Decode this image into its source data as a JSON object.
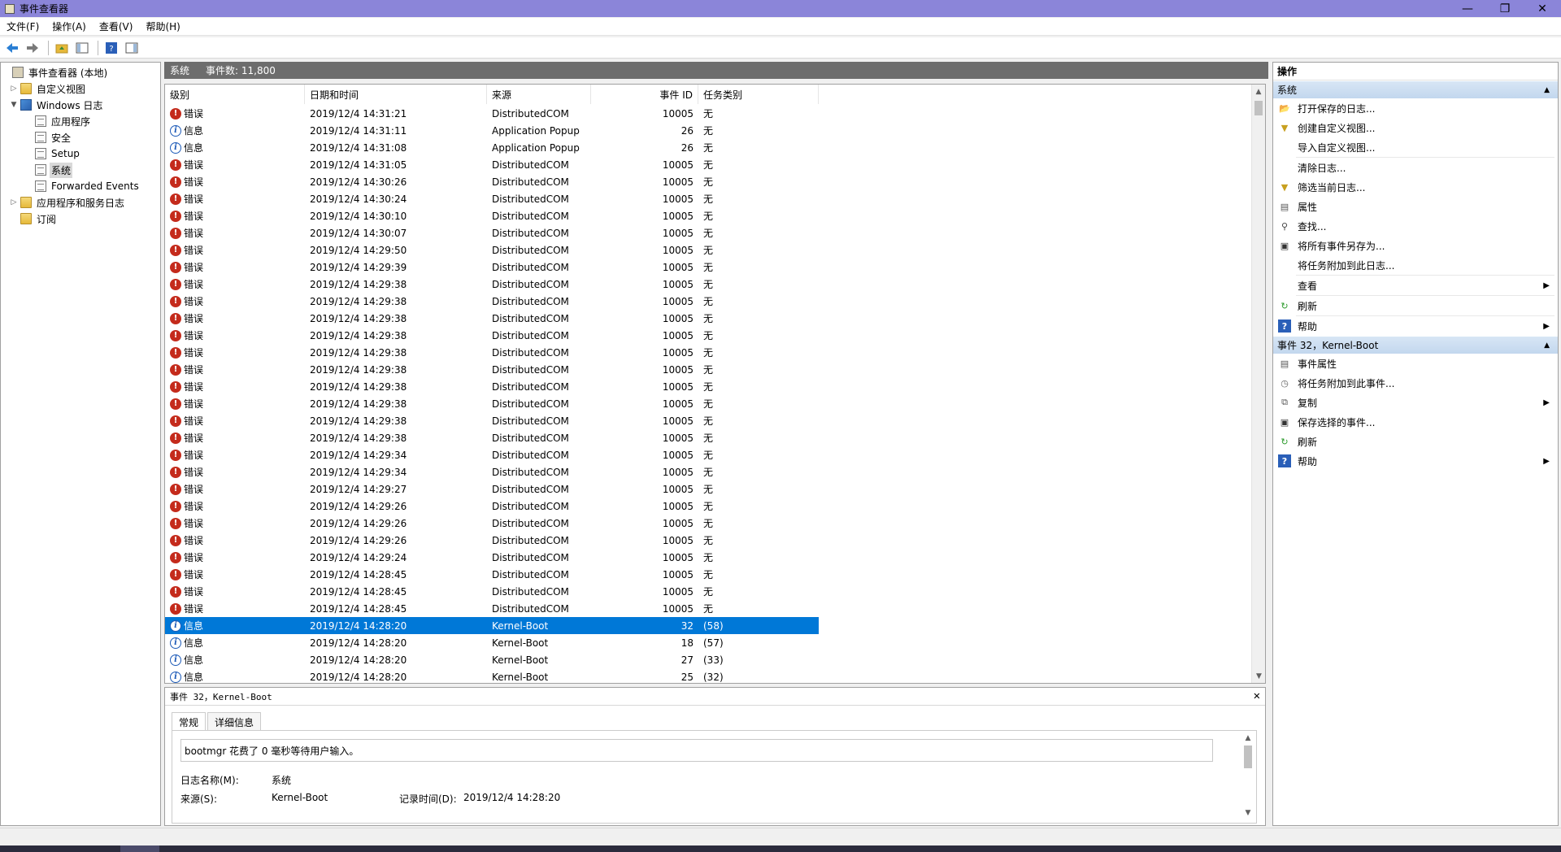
{
  "window": {
    "title": "事件查看器",
    "minimize": "—",
    "restore": "❐",
    "close": "✕"
  },
  "menu": [
    "文件(F)",
    "操作(A)",
    "查看(V)",
    "帮助(H)"
  ],
  "tree": {
    "root": "事件查看器 (本地)",
    "custom_views": "自定义视图",
    "windows_logs": "Windows 日志",
    "windows_log_items": [
      "应用程序",
      "安全",
      "Setup",
      "系统",
      "Forwarded Events"
    ],
    "app_service_logs": "应用程序和服务日志",
    "subscriptions": "订阅"
  },
  "center": {
    "log_name": "系统",
    "event_count": "事件数: 11,800"
  },
  "grid": {
    "columns": [
      "级别",
      "日期和时间",
      "来源",
      "事件 ID",
      "任务类别"
    ],
    "rows": [
      {
        "level": "错误",
        "type": "err",
        "date": "2019/12/4 14:31:21",
        "source": "DistributedCOM",
        "id": "10005",
        "task": "无"
      },
      {
        "level": "信息",
        "type": "info",
        "date": "2019/12/4 14:31:11",
        "source": "Application Popup",
        "id": "26",
        "task": "无"
      },
      {
        "level": "信息",
        "type": "info",
        "date": "2019/12/4 14:31:08",
        "source": "Application Popup",
        "id": "26",
        "task": "无"
      },
      {
        "level": "错误",
        "type": "err",
        "date": "2019/12/4 14:31:05",
        "source": "DistributedCOM",
        "id": "10005",
        "task": "无"
      },
      {
        "level": "错误",
        "type": "err",
        "date": "2019/12/4 14:30:26",
        "source": "DistributedCOM",
        "id": "10005",
        "task": "无"
      },
      {
        "level": "错误",
        "type": "err",
        "date": "2019/12/4 14:30:24",
        "source": "DistributedCOM",
        "id": "10005",
        "task": "无"
      },
      {
        "level": "错误",
        "type": "err",
        "date": "2019/12/4 14:30:10",
        "source": "DistributedCOM",
        "id": "10005",
        "task": "无"
      },
      {
        "level": "错误",
        "type": "err",
        "date": "2019/12/4 14:30:07",
        "source": "DistributedCOM",
        "id": "10005",
        "task": "无"
      },
      {
        "level": "错误",
        "type": "err",
        "date": "2019/12/4 14:29:50",
        "source": "DistributedCOM",
        "id": "10005",
        "task": "无"
      },
      {
        "level": "错误",
        "type": "err",
        "date": "2019/12/4 14:29:39",
        "source": "DistributedCOM",
        "id": "10005",
        "task": "无"
      },
      {
        "level": "错误",
        "type": "err",
        "date": "2019/12/4 14:29:38",
        "source": "DistributedCOM",
        "id": "10005",
        "task": "无"
      },
      {
        "level": "错误",
        "type": "err",
        "date": "2019/12/4 14:29:38",
        "source": "DistributedCOM",
        "id": "10005",
        "task": "无"
      },
      {
        "level": "错误",
        "type": "err",
        "date": "2019/12/4 14:29:38",
        "source": "DistributedCOM",
        "id": "10005",
        "task": "无"
      },
      {
        "level": "错误",
        "type": "err",
        "date": "2019/12/4 14:29:38",
        "source": "DistributedCOM",
        "id": "10005",
        "task": "无"
      },
      {
        "level": "错误",
        "type": "err",
        "date": "2019/12/4 14:29:38",
        "source": "DistributedCOM",
        "id": "10005",
        "task": "无"
      },
      {
        "level": "错误",
        "type": "err",
        "date": "2019/12/4 14:29:38",
        "source": "DistributedCOM",
        "id": "10005",
        "task": "无"
      },
      {
        "level": "错误",
        "type": "err",
        "date": "2019/12/4 14:29:38",
        "source": "DistributedCOM",
        "id": "10005",
        "task": "无"
      },
      {
        "level": "错误",
        "type": "err",
        "date": "2019/12/4 14:29:38",
        "source": "DistributedCOM",
        "id": "10005",
        "task": "无"
      },
      {
        "level": "错误",
        "type": "err",
        "date": "2019/12/4 14:29:38",
        "source": "DistributedCOM",
        "id": "10005",
        "task": "无"
      },
      {
        "level": "错误",
        "type": "err",
        "date": "2019/12/4 14:29:38",
        "source": "DistributedCOM",
        "id": "10005",
        "task": "无"
      },
      {
        "level": "错误",
        "type": "err",
        "date": "2019/12/4 14:29:34",
        "source": "DistributedCOM",
        "id": "10005",
        "task": "无"
      },
      {
        "level": "错误",
        "type": "err",
        "date": "2019/12/4 14:29:34",
        "source": "DistributedCOM",
        "id": "10005",
        "task": "无"
      },
      {
        "level": "错误",
        "type": "err",
        "date": "2019/12/4 14:29:27",
        "source": "DistributedCOM",
        "id": "10005",
        "task": "无"
      },
      {
        "level": "错误",
        "type": "err",
        "date": "2019/12/4 14:29:26",
        "source": "DistributedCOM",
        "id": "10005",
        "task": "无"
      },
      {
        "level": "错误",
        "type": "err",
        "date": "2019/12/4 14:29:26",
        "source": "DistributedCOM",
        "id": "10005",
        "task": "无"
      },
      {
        "level": "错误",
        "type": "err",
        "date": "2019/12/4 14:29:26",
        "source": "DistributedCOM",
        "id": "10005",
        "task": "无"
      },
      {
        "level": "错误",
        "type": "err",
        "date": "2019/12/4 14:29:24",
        "source": "DistributedCOM",
        "id": "10005",
        "task": "无"
      },
      {
        "level": "错误",
        "type": "err",
        "date": "2019/12/4 14:28:45",
        "source": "DistributedCOM",
        "id": "10005",
        "task": "无"
      },
      {
        "level": "错误",
        "type": "err",
        "date": "2019/12/4 14:28:45",
        "source": "DistributedCOM",
        "id": "10005",
        "task": "无"
      },
      {
        "level": "错误",
        "type": "err",
        "date": "2019/12/4 14:28:45",
        "source": "DistributedCOM",
        "id": "10005",
        "task": "无"
      },
      {
        "level": "信息",
        "type": "info",
        "date": "2019/12/4 14:28:20",
        "source": "Kernel-Boot",
        "id": "32",
        "task": "(58)",
        "selected": true
      },
      {
        "level": "信息",
        "type": "info",
        "date": "2019/12/4 14:28:20",
        "source": "Kernel-Boot",
        "id": "18",
        "task": "(57)"
      },
      {
        "level": "信息",
        "type": "info",
        "date": "2019/12/4 14:28:20",
        "source": "Kernel-Boot",
        "id": "27",
        "task": "(33)"
      },
      {
        "level": "信息",
        "type": "info",
        "date": "2019/12/4 14:28:20",
        "source": "Kernel-Boot",
        "id": "25",
        "task": "(32)"
      }
    ]
  },
  "detail": {
    "header": "事件 32，Kernel-Boot",
    "close": "✕",
    "tabs": [
      "常规",
      "详细信息"
    ],
    "message": "bootmgr 花费了 0 毫秒等待用户输入。",
    "log_name_label": "日志名称(M):",
    "log_name_value": "系统",
    "source_label": "来源(S):",
    "source_value": "Kernel-Boot",
    "logged_label": "记录时间(D):",
    "logged_value": "2019/12/4 14:28:20"
  },
  "actions": {
    "title": "操作",
    "section1": "系统",
    "section1_items": [
      {
        "label": "打开保存的日志...",
        "icon": "open-log-icon",
        "sub": false
      },
      {
        "label": "创建自定义视图...",
        "icon": "filter-icon",
        "sub": false
      },
      {
        "label": "导入自定义视图...",
        "icon": "",
        "sub": false
      },
      {
        "label": "清除日志...",
        "icon": "",
        "sub": false
      },
      {
        "label": "筛选当前日志...",
        "icon": "filter-icon",
        "sub": false
      },
      {
        "label": "属性",
        "icon": "properties-icon",
        "sub": false
      },
      {
        "label": "查找...",
        "icon": "find-icon",
        "sub": false
      },
      {
        "label": "将所有事件另存为...",
        "icon": "save-icon",
        "sub": false
      },
      {
        "label": "将任务附加到此日志...",
        "icon": "",
        "sub": false
      },
      {
        "label": "查看",
        "icon": "",
        "sub": true
      },
      {
        "label": "刷新",
        "icon": "refresh-icon",
        "sub": false
      },
      {
        "label": "帮助",
        "icon": "help-icon",
        "sub": true
      }
    ],
    "section2": "事件 32，Kernel-Boot",
    "section2_items": [
      {
        "label": "事件属性",
        "icon": "properties-icon",
        "sub": false
      },
      {
        "label": "将任务附加到此事件...",
        "icon": "task-icon",
        "sub": false
      },
      {
        "label": "复制",
        "icon": "copy-icon",
        "sub": true
      },
      {
        "label": "保存选择的事件...",
        "icon": "save-icon",
        "sub": false
      },
      {
        "label": "刷新",
        "icon": "refresh-icon",
        "sub": false
      },
      {
        "label": "帮助",
        "icon": "help-icon",
        "sub": true
      }
    ]
  },
  "colors": {
    "titlebar": "#8b85d9",
    "selection": "#0078d7",
    "error": "#c42b1c",
    "info": "#1e5bb8"
  }
}
